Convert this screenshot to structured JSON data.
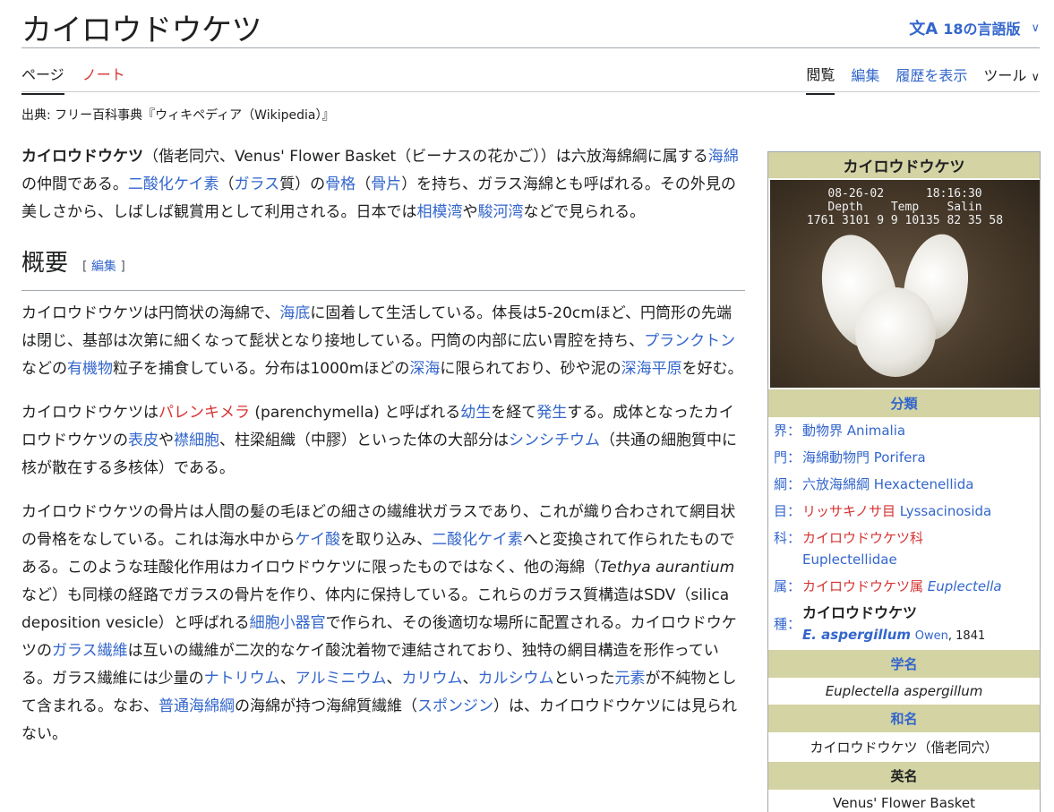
{
  "title": "カイロウドウケツ",
  "lang_button": "18の言語版",
  "tabs_left": [
    "ページ",
    "ノート"
  ],
  "tabs_right": [
    "閲覧",
    "編集",
    "履歴を表示",
    "ツール"
  ],
  "from_line": "出典: フリー百科事典『ウィキペディア（Wikipedia）』",
  "intro": {
    "bold": "カイロウドウケツ",
    "p1a": "（偕老同穴、Venus' Flower Basket（ビーナスの花かご））は六放海綿綱に属する",
    "l1": "海綿",
    "p1b": "の仲間である。",
    "l2": "二酸化ケイ素",
    "p1c": "（",
    "l3": "ガラス",
    "p1d": "質）の",
    "l4": "骨格",
    "p1e": "（",
    "l5": "骨片",
    "p1f": "）を持ち、ガラス海綿とも呼ばれる。その外見の美しさから、しばしば観賞用として利用される。日本では",
    "l6": "相模湾",
    "p1g": "や",
    "l7": "駿河湾",
    "p1h": "などで見られる。"
  },
  "section_heading": "概要",
  "edit_label": "編集",
  "para2": {
    "a": "カイロウドウケツは円筒状の海綿で、",
    "l1": "海底",
    "b": "に固着して生活している。体長は5-20cmほど、円筒形の先端は閉じ、基部は次第に細くなって髭状となり接地している。円筒の内部に広い胃腔を持ち、",
    "l2": "プランクトン",
    "c": "などの",
    "l3": "有機物",
    "d": "粒子を捕食している。分布は1000mほどの",
    "l4": "深海",
    "e": "に限られており、砂や泥の",
    "l5": "深海平原",
    "f": "を好む。"
  },
  "para3": {
    "a": "カイロウドウケツは",
    "r1": "パレンキメラ",
    "b": " (parenchymella) と呼ばれる",
    "l1": "幼生",
    "c": "を経て",
    "l2": "発生",
    "d": "する。成体となったカイロウドウケツの",
    "l3": "表皮",
    "e": "や",
    "l4": "襟細胞",
    "f": "、柱梁組織（中膠）といった体の大部分は",
    "l5": "シンシチウム",
    "g": "（共通の細胞質中に核が散在する多核体）である。"
  },
  "para4": {
    "a": "カイロウドウケツの骨片は人間の髪の毛ほどの細さの繊維状ガラスであり、これが織り合わされて網目状の骨格をなしている。これは海水中から",
    "l1": "ケイ酸",
    "b": "を取り込み、",
    "l2": "二酸化ケイ素",
    "c": "へと変換されて作られたものである。このような珪酸化作用はカイロウドウケツに限ったものではなく、他の海綿（",
    "i1": "Tethya aurantium",
    "d": " など）も同様の経路でガラスの骨片を作り、体内に保持している。これらのガラス質構造はSDV（silica deposition vesicle）と呼ばれる",
    "l3": "細胞小器官",
    "e": "で作られ、その後適切な場所に配置される。カイロウドウケツの",
    "l4": "ガラス繊維",
    "f": "は互いの繊維が二次的なケイ酸沈着物で連結されており、独特の網目構造を形作っている。ガラス繊維には少量の",
    "l5": "ナトリウム",
    "g": "、",
    "l6": "アルミニウム",
    "h": "、",
    "l7": "カリウム",
    "i": "、",
    "l8": "カルシウム",
    "j": "といった",
    "l9": "元素",
    "k": "が不純物として含まれる。なお、",
    "l10": "普通海綿綱",
    "l": "の海綿が持つ海綿質繊維（",
    "l11": "スポンジン",
    "m": "）は、カイロウドウケツには見られない。"
  },
  "infobox": {
    "title": "カイロウドウケツ",
    "image_hud_line1": "08-26-02      18:16:30",
    "image_hud_line2": "Depth    Temp    Salin",
    "image_hud_line3": "1761 3101 9 9 10135 82 35 58",
    "classification_header": "分類",
    "ranks": [
      {
        "k": "界：",
        "name": "動物界",
        "sci": "Animalia",
        "color": "blue"
      },
      {
        "k": "門：",
        "name": "海綿動物門",
        "sci": "Porifera",
        "color": "blue"
      },
      {
        "k": "綱：",
        "name": "六放海綿綱",
        "sci": "Hexactenellida",
        "color": "blue"
      },
      {
        "k": "目：",
        "name": "リッサキノサ目",
        "sci": "Lyssacinosida",
        "color": "red"
      },
      {
        "k": "科：",
        "name": "カイロウドウケツ科",
        "sci": "Euplectellidae",
        "color": "red"
      },
      {
        "k": "属：",
        "name": "カイロウドウケツ属",
        "sci": "Euplectella",
        "color": "red"
      }
    ],
    "species_key": "種：",
    "species_name": "カイロウドウケツ",
    "species_sci": "E. aspergillum",
    "species_author": "Owen",
    "species_year": ", 1841",
    "sciname_header": "学名",
    "sciname": "Euplectella aspergillum",
    "wamei_header": "和名",
    "wamei": "カイロウドウケツ（偕老同穴）",
    "eimei_header": "英名",
    "eimei": "Venus' Flower Basket"
  }
}
